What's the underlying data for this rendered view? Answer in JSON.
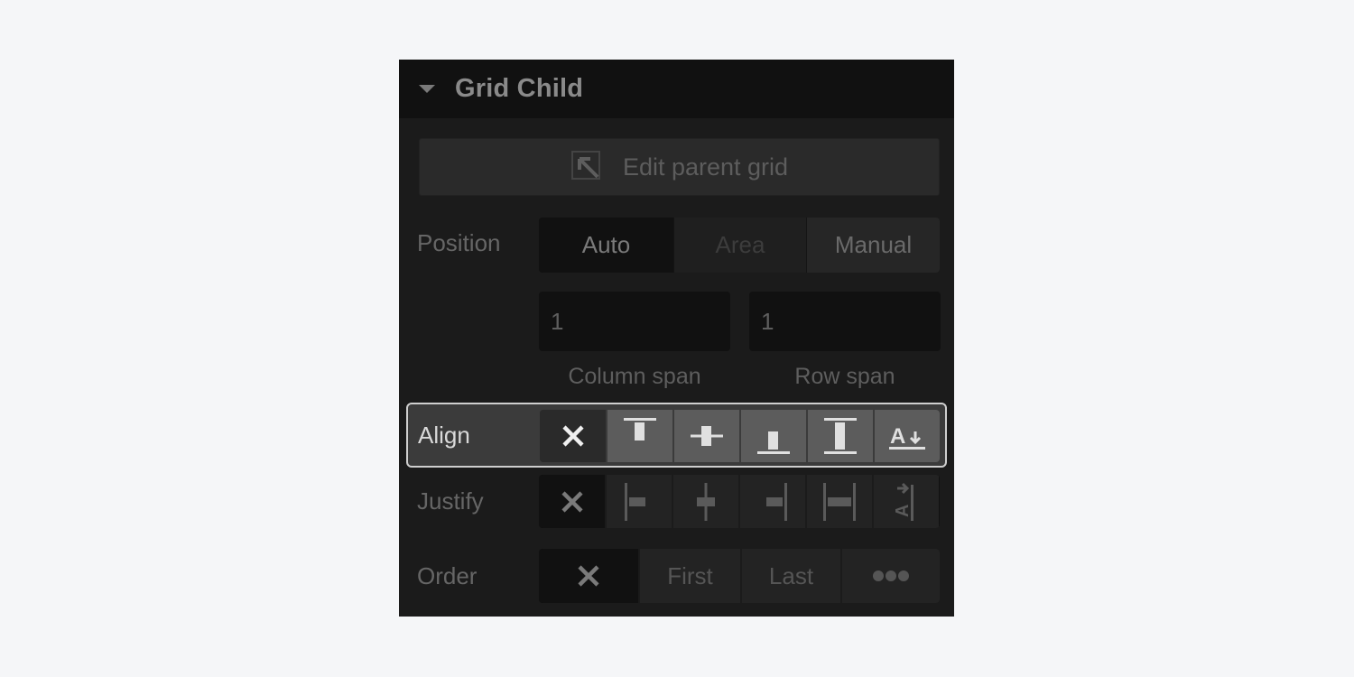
{
  "panel": {
    "title": "Grid Child",
    "collapse_icon": "caret-down-icon",
    "edit_parent": {
      "label": "Edit parent grid",
      "icon": "arrow-up-left-box-icon"
    },
    "position": {
      "label": "Position",
      "options": [
        "Auto",
        "Area",
        "Manual"
      ],
      "selected": "Auto",
      "disabled": [
        "Area"
      ]
    },
    "spans": {
      "column": {
        "value": "1",
        "caption": "Column span"
      },
      "row": {
        "value": "1",
        "caption": "Row span"
      }
    },
    "align": {
      "label": "Align",
      "highlighted": true,
      "options": [
        {
          "icon": "none-x-icon",
          "value": "none"
        },
        {
          "icon": "align-start-icon",
          "value": "start"
        },
        {
          "icon": "align-center-icon",
          "value": "center"
        },
        {
          "icon": "align-end-icon",
          "value": "end"
        },
        {
          "icon": "align-stretch-icon",
          "value": "stretch"
        },
        {
          "icon": "align-baseline-icon",
          "value": "baseline"
        }
      ],
      "selected": "none"
    },
    "justify": {
      "label": "Justify",
      "options": [
        {
          "icon": "none-x-icon",
          "value": "none"
        },
        {
          "icon": "justify-start-icon",
          "value": "start"
        },
        {
          "icon": "justify-center-icon",
          "value": "center"
        },
        {
          "icon": "justify-end-icon",
          "value": "end"
        },
        {
          "icon": "justify-stretch-icon",
          "value": "stretch"
        },
        {
          "icon": "justify-baseline-icon",
          "value": "baseline"
        }
      ],
      "selected": "none"
    },
    "order": {
      "label": "Order",
      "options": [
        "×",
        "First",
        "Last",
        "•••"
      ],
      "selected": "none"
    }
  }
}
